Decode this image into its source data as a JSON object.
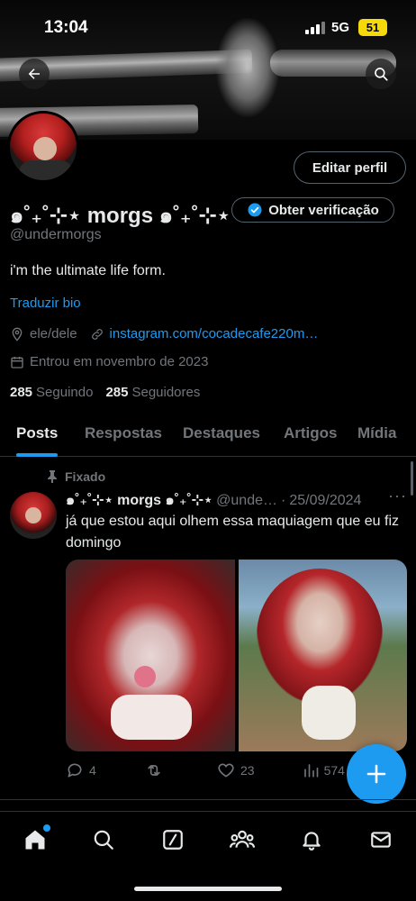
{
  "status_bar": {
    "time": "13:04",
    "network": "5G",
    "battery": "51"
  },
  "profile": {
    "display_name": "๑˚₊˚⊹⋆ morgs ๑˚₊˚⊹⋆",
    "handle": "@undermorgs",
    "bio": "i'm the ultimate life form.",
    "translate_label": "Traduzir bio",
    "pronouns": "ele/dele",
    "link": "instagram.com/cocadecafe220m…",
    "joined": "Entrou em novembro de 2023",
    "following_count": "285",
    "following_label": "Seguindo",
    "followers_count": "285",
    "followers_label": "Seguidores",
    "edit_button": "Editar perfil",
    "verify_button": "Obter verificação"
  },
  "tabs": [
    {
      "label": "Posts",
      "active": true
    },
    {
      "label": "Respostas",
      "active": false
    },
    {
      "label": "Destaques",
      "active": false
    },
    {
      "label": "Artigos",
      "active": false
    },
    {
      "label": "Mídia",
      "active": false
    }
  ],
  "pinned_post": {
    "pinned_label": "Fixado",
    "author_name": "๑˚₊˚⊹⋆ morgs ๑˚₊˚⊹⋆",
    "author_handle": "@unde…",
    "separator": "·",
    "date": "25/09/2024",
    "text": "já que estou aqui olhem essa maquiagem que eu fiz domingo",
    "more": "···",
    "replies": "4",
    "retweets": "",
    "likes": "23",
    "views": "574"
  },
  "colors": {
    "accent": "#1d9bf0",
    "background": "#000000",
    "muted": "#71767b",
    "battery": "#f5d90a"
  },
  "icons": {
    "back": "arrow-left-icon",
    "search": "search-icon",
    "verified": "verified-badge-icon",
    "location": "location-pin-icon",
    "link": "link-icon",
    "calendar": "calendar-icon",
    "pin": "pin-icon",
    "reply": "reply-icon",
    "retweet": "retweet-icon",
    "like": "heart-icon",
    "views": "views-icon",
    "compose": "plus-icon",
    "nav": [
      "home-icon",
      "search-icon",
      "grok-icon",
      "communities-icon",
      "notifications-icon",
      "messages-icon"
    ]
  }
}
